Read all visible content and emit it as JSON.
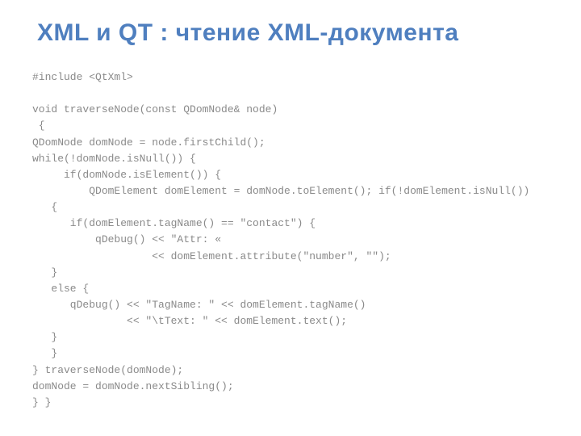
{
  "title": "XML и QT : чтение XML-документа",
  "code": {
    "l01": "#include <QtXml>",
    "l02": "",
    "l03": "void traverseNode(const QDomNode& node)",
    "l04": " {",
    "l05": "QDomNode domNode = node.firstChild();",
    "l06": "while(!domNode.isNull()) {",
    "l07": "     if(domNode.isElement()) {",
    "l08": "         QDomElement domElement = domNode.toElement(); if(!domElement.isNull())",
    "l09": "   {",
    "l10": "      if(domElement.tagName() == \"contact\") {",
    "l11": "          qDebug() << \"Attr: «",
    "l12": "                   << domElement.attribute(\"number\", \"\");",
    "l13": "   }",
    "l14": "   else {",
    "l15": "      qDebug() << \"TagName: \" << domElement.tagName()",
    "l16": "               << \"\\tText: \" << domElement.text();",
    "l17": "   }",
    "l18": "   }",
    "l19": "} traverseNode(domNode);",
    "l20": "domNode = domNode.nextSibling();",
    "l21": "} }"
  }
}
